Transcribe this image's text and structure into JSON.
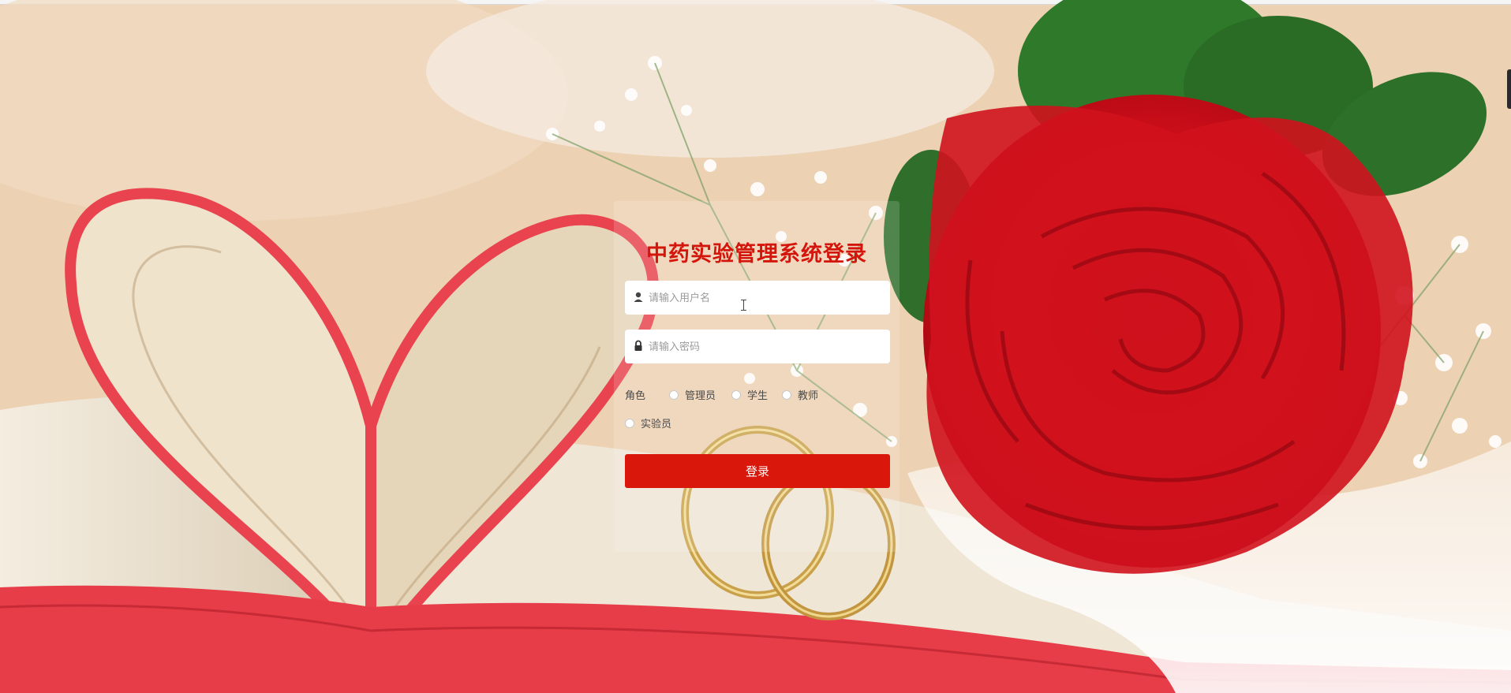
{
  "login": {
    "title": "中药实验管理系统登录",
    "username_placeholder": "请输入用户名",
    "password_placeholder": "请输入密码",
    "role_label": "角色",
    "roles": [
      "管理员",
      "学生",
      "教师",
      "实验员"
    ],
    "submit_label": "登录"
  },
  "colors": {
    "accent": "#d9170b",
    "title": "#d4150b",
    "rose": "#c8101a"
  },
  "icons": {
    "username": "user-icon",
    "password": "lock-icon"
  }
}
